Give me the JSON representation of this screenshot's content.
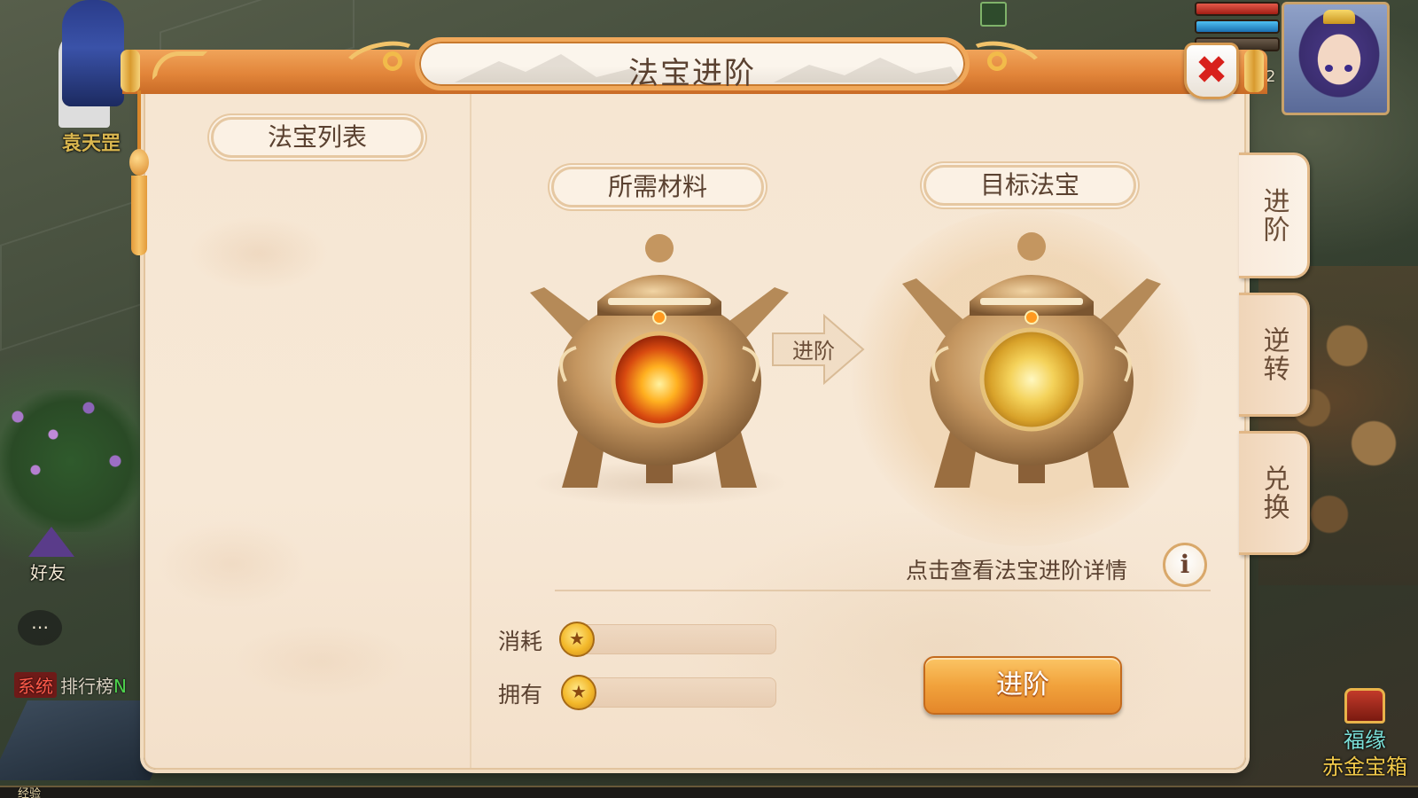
{
  "world": {
    "npc_name": "袁天罡",
    "friend_label": "好友",
    "chat_icon": "chat-bubble-icon",
    "system_tag": "系统",
    "system_text": "排行榜",
    "system_suffix": "N",
    "xp_label": "经验",
    "level_fragment": "2",
    "event": {
      "line1": "福缘",
      "line2": "赤金宝箱"
    }
  },
  "panel": {
    "title": "法宝进阶",
    "close_icon": "close-icon",
    "list_title": "法宝列表",
    "required_title": "所需材料",
    "target_title": "目标法宝",
    "arrow_label": "进阶",
    "details_link": "点击查看法宝进阶详情",
    "info_glyph": "i",
    "cost_label": "消耗",
    "cost_value": "",
    "owned_label": "拥有",
    "owned_value": "",
    "advance_button": "进阶"
  },
  "tabs": [
    {
      "label": "进阶",
      "active": true
    },
    {
      "label": "逆转",
      "active": false
    },
    {
      "label": "兑换",
      "active": false
    }
  ],
  "colors": {
    "accent_orange": "#e2853a",
    "close_red": "#d8211c",
    "text_brown": "#5a4130",
    "parchment": "#f6e6d2"
  }
}
